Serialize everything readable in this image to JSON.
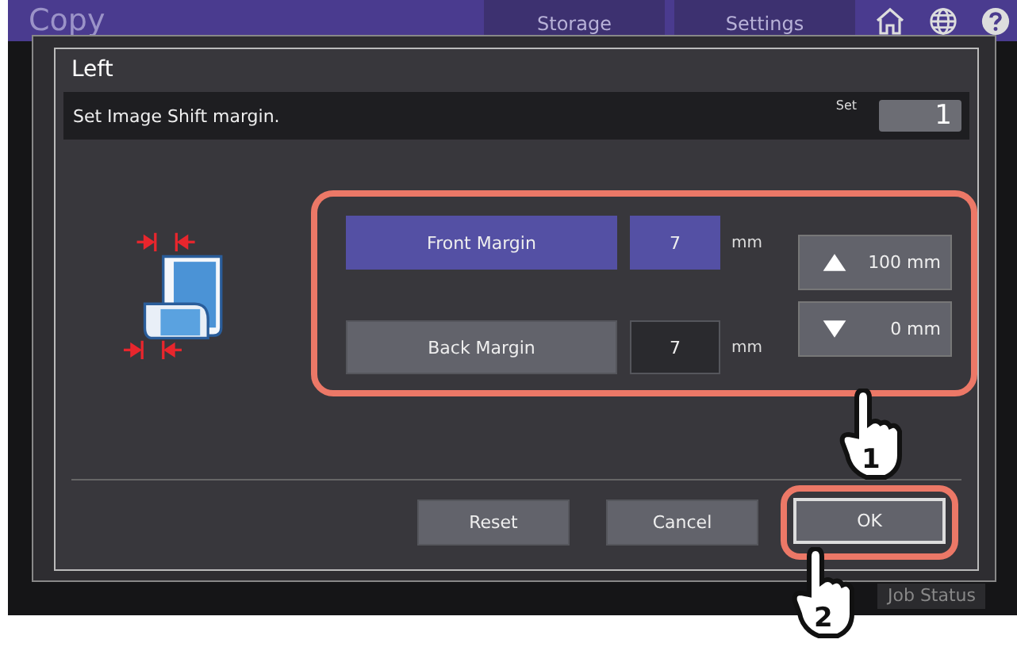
{
  "app": {
    "title": "Copy",
    "tabs": [
      {
        "label": "Storage",
        "selected": false
      },
      {
        "label": "Settings",
        "selected": false
      }
    ],
    "job_status": "Job Status"
  },
  "dialog": {
    "title": "Left",
    "message": "Set Image Shift margin.",
    "set_label": "Set",
    "set_value": "1",
    "margins_highlighted": true,
    "margins": [
      {
        "label": "Front Margin",
        "value": "7",
        "unit": "mm",
        "selected": true
      },
      {
        "label": "Back Margin",
        "value": "7",
        "unit": "mm",
        "selected": false
      }
    ],
    "steppers": [
      {
        "kind": "up",
        "label": "100 mm"
      },
      {
        "kind": "down",
        "label": "0 mm"
      }
    ],
    "buttons": [
      {
        "label": "Reset",
        "highlighted": false
      },
      {
        "label": "Cancel",
        "highlighted": false
      },
      {
        "label": "OK",
        "highlighted": true
      }
    ]
  },
  "callouts": [
    {
      "number": "1"
    },
    {
      "number": "2"
    }
  ]
}
